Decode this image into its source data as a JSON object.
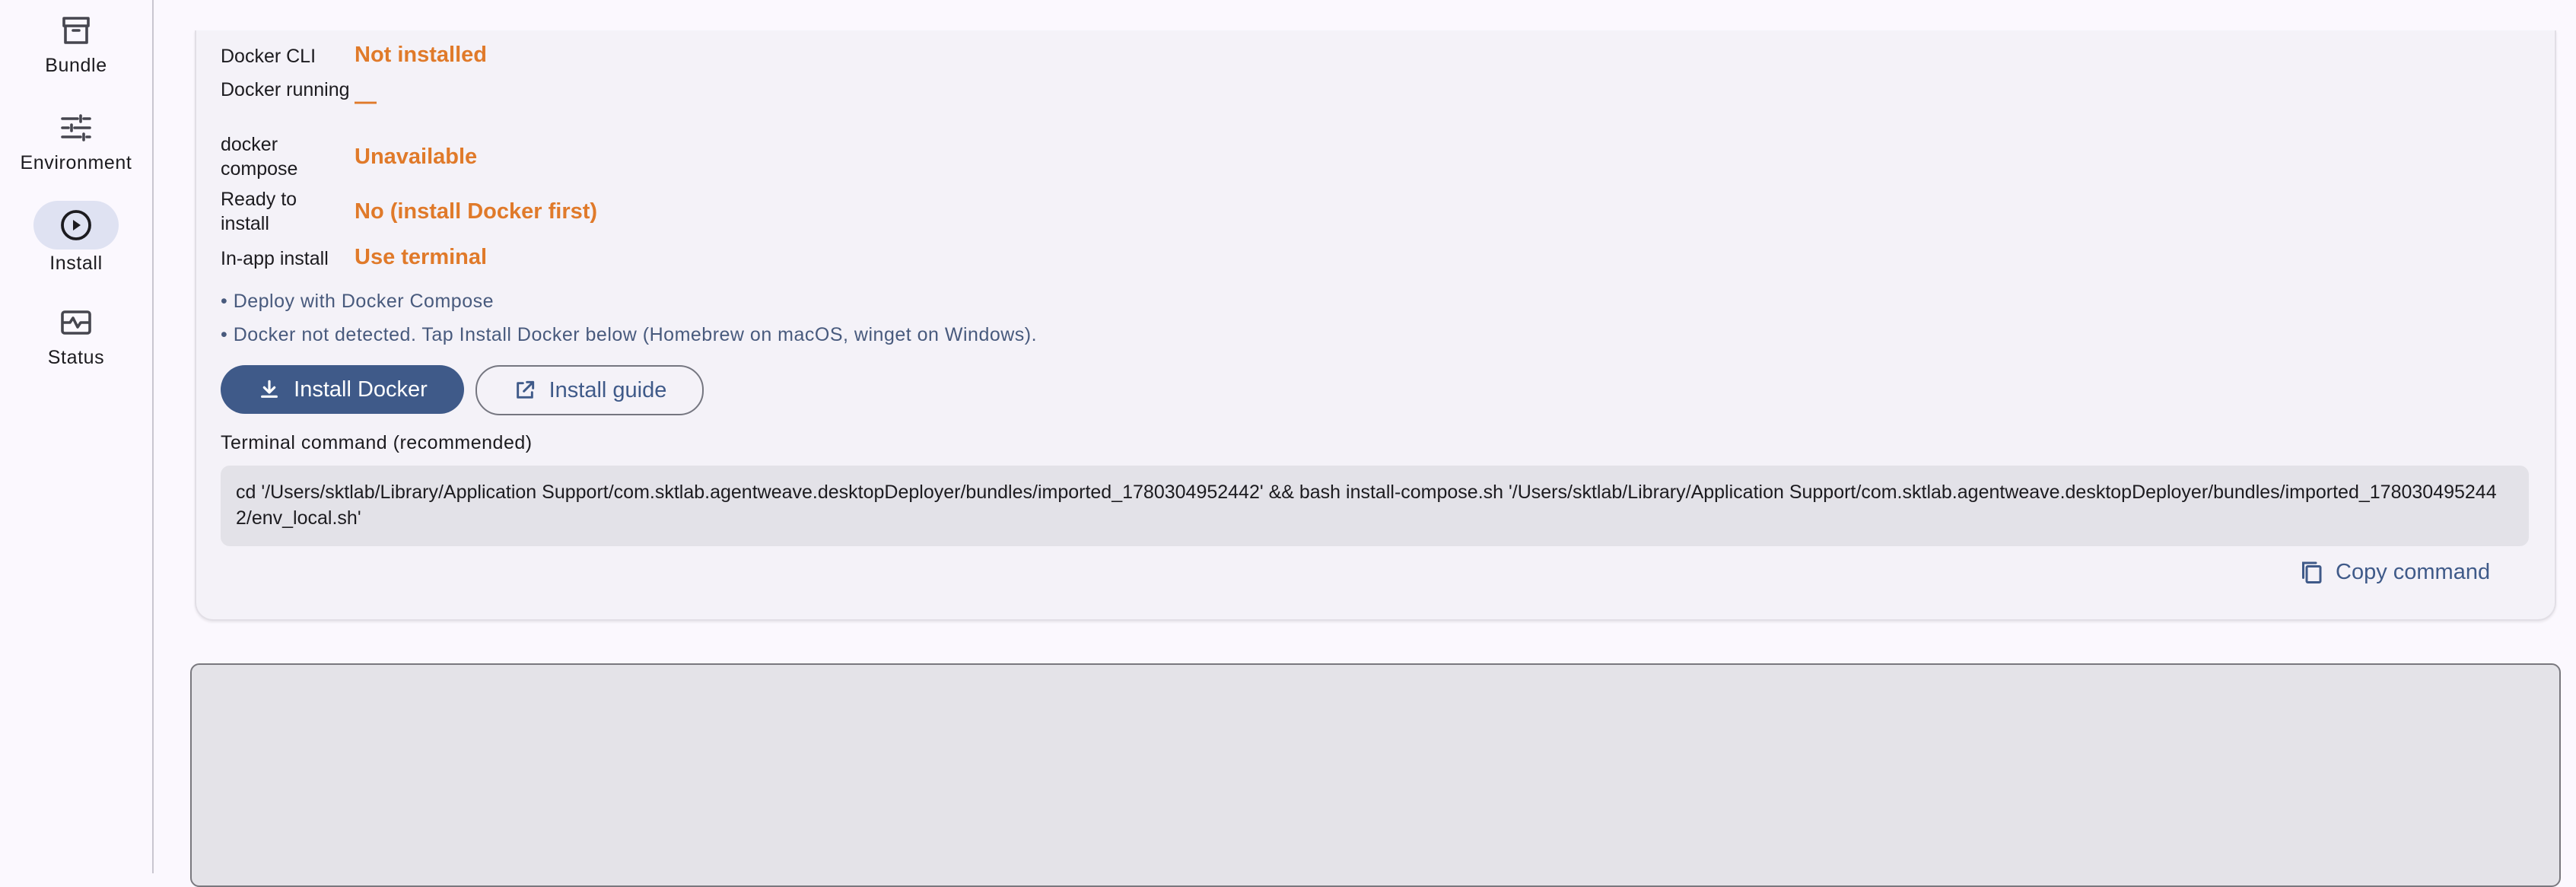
{
  "sidebar": {
    "items": [
      {
        "label": "Bundle",
        "icon": "archive-icon",
        "active": false
      },
      {
        "label": "Environment",
        "icon": "tune-icon",
        "active": false
      },
      {
        "label": "Install",
        "icon": "play-circle-icon",
        "active": true
      },
      {
        "label": "Status",
        "icon": "monitor-heart-icon",
        "active": false
      }
    ]
  },
  "status": {
    "docker_cli": {
      "label": "Docker CLI",
      "value": "Not installed"
    },
    "docker_running": {
      "label": "Docker running",
      "value": "—"
    },
    "docker_compose": {
      "label": "docker compose",
      "value": "Unavailable"
    },
    "ready": {
      "label": "Ready to install",
      "value": "No (install Docker first)"
    },
    "in_app": {
      "label": "In-app install",
      "value": "Use terminal"
    }
  },
  "notes": [
    "• Deploy with Docker Compose",
    "• Docker not detected. Tap Install Docker below (Homebrew on macOS, winget on Windows)."
  ],
  "actions": {
    "install_docker": "Install Docker",
    "install_guide": "Install guide",
    "copy_command": "Copy command"
  },
  "terminal": {
    "heading": "Terminal command (recommended)",
    "command": "cd '/Users/sktlab/Library/Application Support/com.sktlab.agentweave.desktopDeployer/bundles/imported_1780304952442' && bash install-compose.sh '/Users/sktlab/Library/Application Support/com.sktlab.agentweave.desktopDeployer/bundles/imported_1780304952442/env_local.sh'"
  },
  "colors": {
    "accent": "#3f5a89",
    "warning": "#e07a2a",
    "active_pill": "#dfe2f2"
  }
}
